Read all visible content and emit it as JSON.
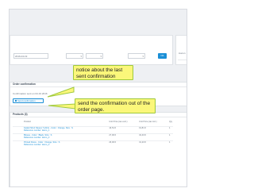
{
  "top_panel": {
    "date_field_value": "2016-04-19",
    "ok_label": "OK",
    "side_text": "Aucun"
  },
  "confirmation_section": {
    "title": "Order confirmation",
    "last_sent_text": "Confirmation sent on 04.19 2016",
    "send_button_label": "Send confirmation"
  },
  "products_section": {
    "title": "Products (3)",
    "columns": [
      "Product",
      "Unit Price (tax excl.)",
      "Unit Price (tax incl.)",
      "Qty"
    ],
    "rows": [
      {
        "name": "Faded Short Sleeve T-shirts - Color : Orange, Size : S",
        "ref": "Reference number: demo_1",
        "price_excl": "16,51 €",
        "price_incl": "19,81 €",
        "qty": "1"
      },
      {
        "name": "Blouse - Color : Black, Size : S",
        "ref": "Reference number: demo_2",
        "price_excl": "27,00 €",
        "price_incl": "32,40 €",
        "qty": "1"
      },
      {
        "name": "Printed Dress - Color : Orange, Size : S",
        "ref": "Reference number: demo_3",
        "price_excl": "26,00 €",
        "price_incl": "31,20 €",
        "qty": "1"
      }
    ]
  },
  "annotations": {
    "notice": "notice about the last sent confirmation",
    "send": "send the confirmation out of the order page."
  },
  "colors": {
    "callout_bg": "#fbf77a",
    "callout_border": "#9fc93c",
    "accent": "#1b8fd6"
  }
}
